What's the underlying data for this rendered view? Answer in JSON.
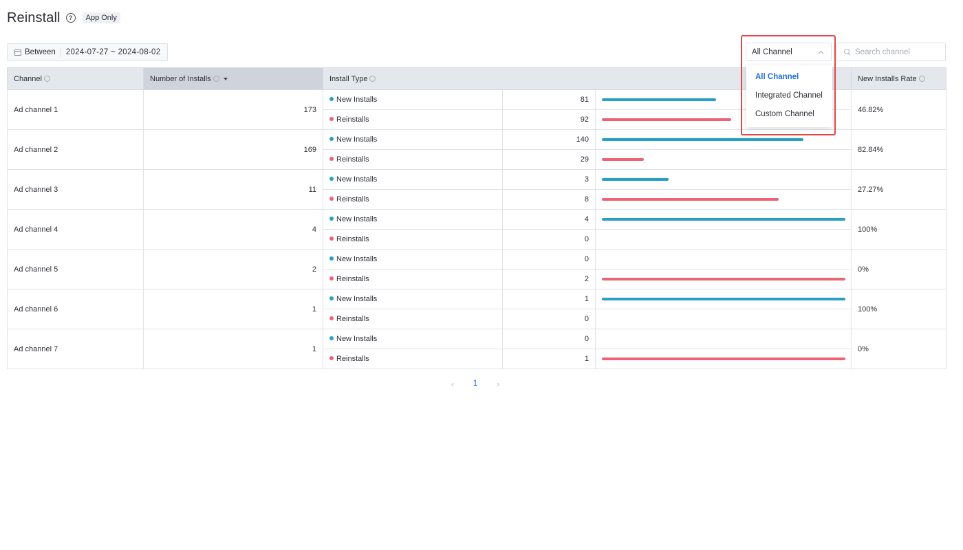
{
  "header": {
    "title": "Reinstall",
    "help_glyph": "?",
    "badge": "App Only"
  },
  "filters": {
    "date_label": "Between",
    "date_range": "2024-07-27 ~ 2024-08-02",
    "channel_select_value": "All Channel",
    "search_placeholder": "Search channel"
  },
  "dropdown": {
    "options": [
      {
        "label": "All Channel",
        "selected": true
      },
      {
        "label": "Integrated Channel",
        "selected": false
      },
      {
        "label": "Custom Channel",
        "selected": false
      }
    ]
  },
  "table": {
    "columns": {
      "channel": "Channel",
      "installs": "Number of Installs",
      "install_type": "Install Type",
      "rate": "New Installs Rate"
    },
    "type_labels": {
      "new": "New Installs",
      "re": "Reinstalls"
    },
    "rows": [
      {
        "channel": "Ad channel 1",
        "total": "173",
        "new": "81",
        "re": "92",
        "rate": "46.82%"
      },
      {
        "channel": "Ad channel 2",
        "total": "169",
        "new": "140",
        "re": "29",
        "rate": "82.84%"
      },
      {
        "channel": "Ad channel 3",
        "total": "11",
        "new": "3",
        "re": "8",
        "rate": "27.27%"
      },
      {
        "channel": "Ad channel 4",
        "total": "4",
        "new": "4",
        "re": "0",
        "rate": "100%"
      },
      {
        "channel": "Ad channel 5",
        "total": "2",
        "new": "0",
        "re": "2",
        "rate": "0%"
      },
      {
        "channel": "Ad channel 6",
        "total": "1",
        "new": "1",
        "re": "0",
        "rate": "100%"
      },
      {
        "channel": "Ad channel 7",
        "total": "1",
        "new": "0",
        "re": "1",
        "rate": "0%"
      }
    ]
  },
  "pagination": {
    "prev": "‹",
    "page": "1",
    "next": "›"
  },
  "colors": {
    "new_installs": "#2a9fc6",
    "reinstalls": "#ec6474",
    "accent": "#1f6fe0",
    "highlight": "#e04848"
  }
}
